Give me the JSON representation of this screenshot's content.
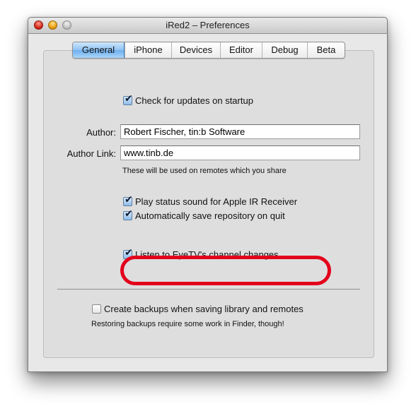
{
  "window": {
    "title": "iRed2 – Preferences",
    "controls": [
      "close",
      "minimize",
      "zoom"
    ]
  },
  "tabs": [
    {
      "label": "General",
      "active": true
    },
    {
      "label": "iPhone",
      "active": false
    },
    {
      "label": "Devices",
      "active": false
    },
    {
      "label": "Editor",
      "active": false
    },
    {
      "label": "Debug",
      "active": false
    },
    {
      "label": "Beta",
      "active": false
    }
  ],
  "general": {
    "check_updates": {
      "label": "Check for updates on startup",
      "checked": true
    },
    "author": {
      "label": "Author:",
      "value": "Robert Fischer, tin:b Software"
    },
    "author_link": {
      "label": "Author Link:",
      "value": "www.tinb.de"
    },
    "share_note": "These will be used on remotes which you share",
    "play_sound": {
      "label": "Play status sound for Apple IR Receiver",
      "checked": true
    },
    "auto_save": {
      "label": "Automatically save repository on quit",
      "checked": true
    },
    "eyetv": {
      "label": "Listen to EyeTV's channel changes",
      "checked": true
    },
    "backups": {
      "label": "Create backups when saving library and remotes",
      "checked": false
    },
    "backups_note": "Restoring backups require some work in Finder, though!"
  },
  "annotation": {
    "color": "#e3001b",
    "target": "eyetv"
  },
  "icons": {
    "check": "✔"
  }
}
